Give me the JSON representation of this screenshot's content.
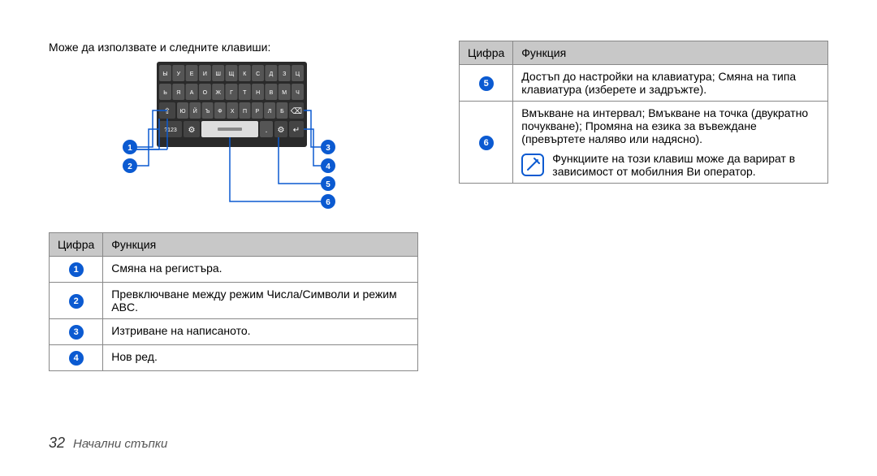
{
  "intro": "Може да използвате и следните клавиши:",
  "table_headers": {
    "num": "Цифра",
    "func": "Функция"
  },
  "left_rows": [
    {
      "n": "1",
      "desc": "Смяна на регистъра."
    },
    {
      "n": "2",
      "desc": "Превключване между режим Числа/Символи и режим ABC."
    },
    {
      "n": "3",
      "desc": "Изтриване на написаното."
    },
    {
      "n": "4",
      "desc": "Нов ред."
    }
  ],
  "right_rows": [
    {
      "n": "5",
      "desc": "Достъп до настройки на клавиатура; Смяна на типа клавиатура (изберете и задръжте)."
    },
    {
      "n": "6",
      "desc": "Вмъкване на интервал; Вмъкване на точка (двукратно почукване); Промяна на езика за въвеждане (превъртете наляво или надясно).",
      "note": "Функциите на този клавиш може да варират в зависимост от мобилния Ви оператор."
    }
  ],
  "keyboard": {
    "row1": [
      "Ы",
      "У",
      "Е",
      "И",
      "Ш",
      "Щ",
      "К",
      "С",
      "Д",
      "З",
      "Ц"
    ],
    "row2": [
      "Ь",
      "Я",
      "А",
      "О",
      "Ж",
      "Г",
      "Т",
      "Н",
      "В",
      "М",
      "Ч"
    ],
    "row3_mid": [
      "Ю",
      "Й",
      "Ъ",
      "Ф",
      "Х",
      "П",
      "Р",
      "Л",
      "Б"
    ],
    "row3_shift": "⇧",
    "row3_back": "⌫",
    "row4_mode": "?123",
    "row4_gear": "⚙",
    "row4_dot": ".",
    "row4_enter": "↵",
    "callouts": {
      "n1": "1",
      "n2": "2",
      "n3": "3",
      "n4": "4",
      "n5": "5",
      "n6": "6"
    }
  },
  "footer": {
    "page": "32",
    "section": "Начални стъпки"
  }
}
